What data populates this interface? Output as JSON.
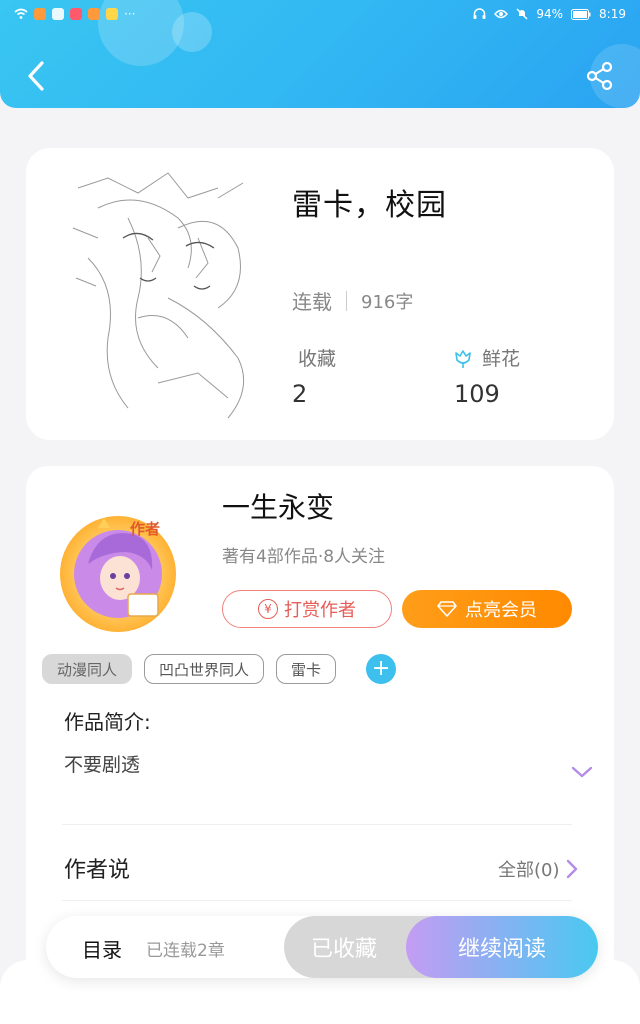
{
  "statusbar": {
    "battery": "94%",
    "time": "8:19"
  },
  "colors": {
    "accent": "#35b8f2",
    "tip": "#e55d57",
    "vip": "#ff8f10"
  },
  "book": {
    "title": "雷卡，校园",
    "status": "连载",
    "word_count": "916字",
    "collect_label": "收藏",
    "collect_value": "2",
    "flower_label": "鲜花",
    "flower_value": "109"
  },
  "author": {
    "badge": "作者",
    "name": "一生永变",
    "meta": "著有4部作品·8人关注",
    "tip_label": "打赏作者",
    "tip_icon_text": "¥",
    "vip_label": "点亮会员"
  },
  "tags": [
    {
      "label": "动漫同人"
    },
    {
      "label": "凹凸世界同人"
    },
    {
      "label": "雷卡"
    }
  ],
  "tag_add": "+",
  "intro": {
    "title": "作品简介:",
    "text": "不要剧透"
  },
  "author_say": {
    "title": "作者说",
    "all_label": "全部(0)"
  },
  "bottom": {
    "toc_label": "目录",
    "serial_label": "已连载2章",
    "collected_label": "已收藏",
    "read_label": "继续阅读"
  }
}
